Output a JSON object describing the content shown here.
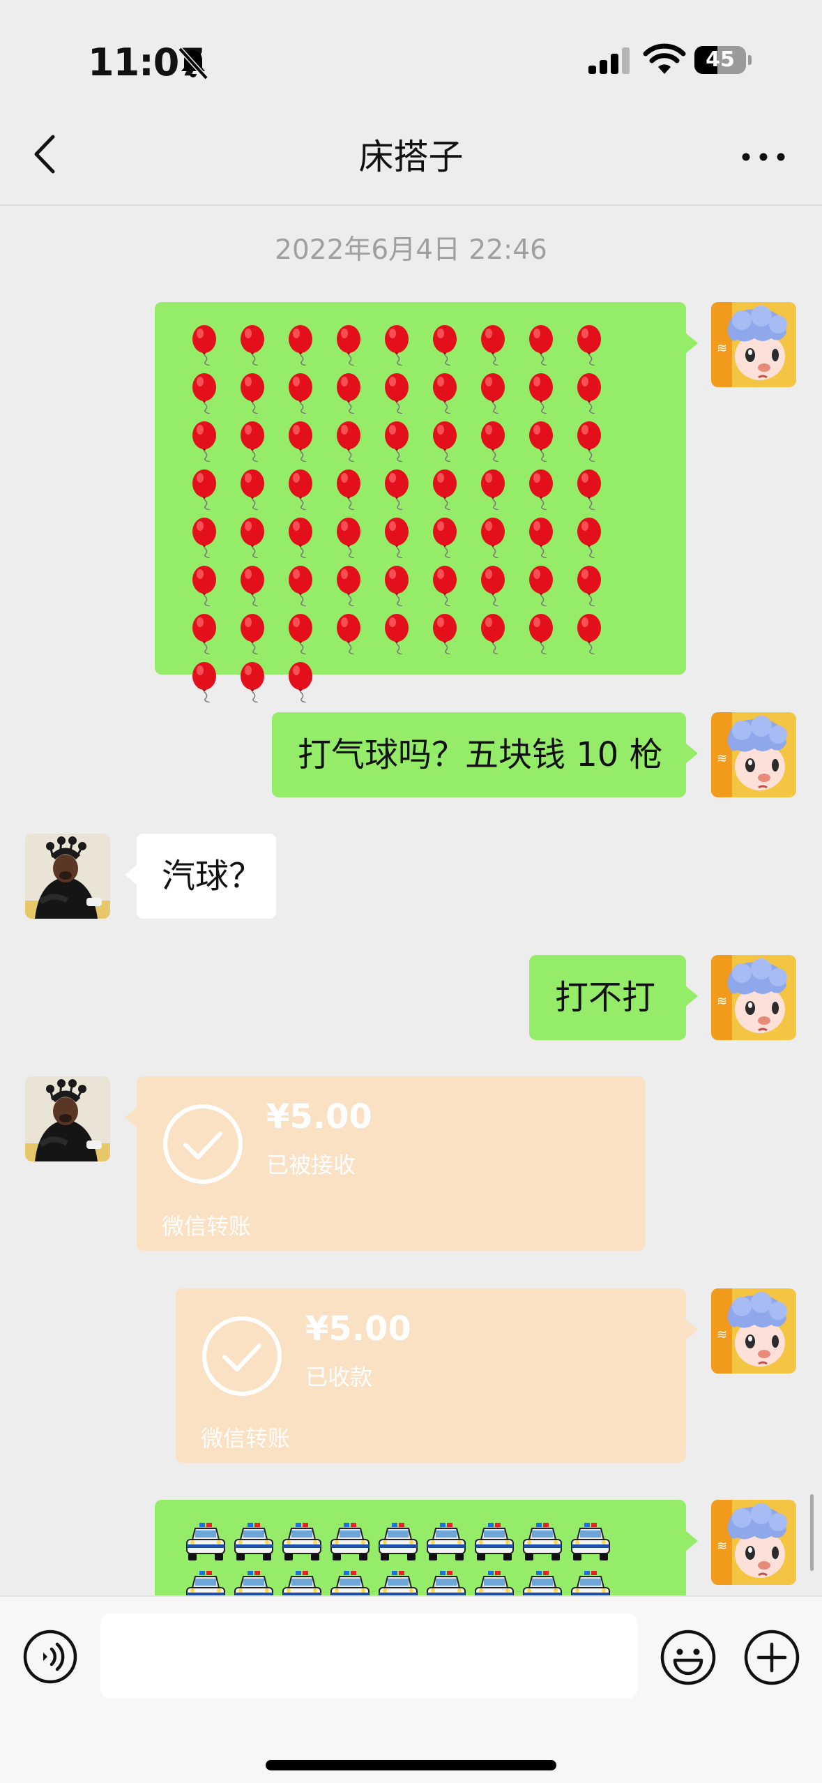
{
  "status_bar": {
    "time": "11:07",
    "battery_percent": "45",
    "battery_level": 0.45,
    "icons": [
      "silent-bell-icon",
      "signal-icon",
      "wifi-icon",
      "battery-icon"
    ]
  },
  "nav": {
    "title": "床搭子",
    "back_icon": "chevron-left-icon",
    "more_icon": "more-dots-icon"
  },
  "chat": {
    "timestamp": "2022年6月4日 22:46",
    "messages": [
      {
        "side": "right",
        "type": "emoji-grid",
        "emoji": "🎈",
        "count": 66
      },
      {
        "side": "right",
        "type": "text",
        "text": "打气球吗？五块钱 10 枪"
      },
      {
        "side": "left",
        "type": "text",
        "text": "汽球？"
      },
      {
        "side": "right",
        "type": "text",
        "text": "打不打"
      },
      {
        "side": "left",
        "type": "transfer",
        "amount": "¥5.00",
        "status": "已被接收",
        "label": "微信转账"
      },
      {
        "side": "right",
        "type": "transfer",
        "amount": "¥5.00",
        "status": "已收款",
        "label": "微信转账"
      },
      {
        "side": "right",
        "type": "emoji-grid",
        "emoji": "🚔",
        "count": 20
      }
    ]
  },
  "input_bar": {
    "placeholder": "",
    "value": "",
    "icons": [
      "voice-icon",
      "emoji-face-icon",
      "plus-icon"
    ]
  },
  "colors": {
    "background": "#ededed",
    "bubble_self": "#95ec69",
    "bubble_other": "#ffffff",
    "transfer": "#fbe1c3"
  }
}
